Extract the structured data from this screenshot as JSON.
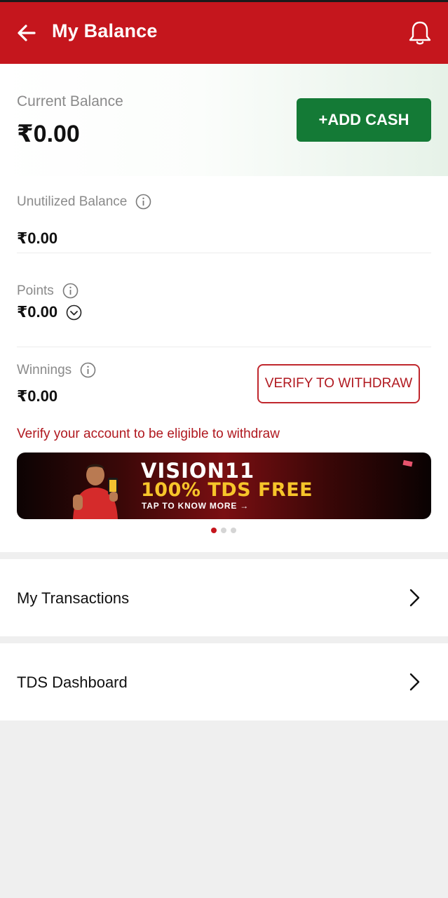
{
  "header": {
    "title": "My Balance",
    "back_icon": "arrow-left-icon",
    "bell_icon": "bell-icon",
    "color": "#c5161d"
  },
  "current_balance": {
    "label": "Current Balance",
    "value": "₹0.00",
    "add_cash_label": "+ADD CASH",
    "add_cash_color": "#147a36"
  },
  "unutilized": {
    "label": "Unutilized Balance",
    "value": "₹0.00"
  },
  "points": {
    "label": "Points",
    "value": "₹0.00"
  },
  "winnings": {
    "label": "Winnings",
    "value": "₹0.00",
    "verify_label": "VERIFY TO WITHDRAW",
    "note": "Verify your account to be eligible to withdraw"
  },
  "banner": {
    "brand": "VISION11",
    "headline": "100% TDS FREE",
    "cta": "TAP TO KNOW MORE →",
    "slides": 3,
    "active_slide": 1
  },
  "menu": [
    {
      "label": "My Transactions",
      "icon": "chevron-right-icon"
    },
    {
      "label": "TDS Dashboard",
      "icon": "chevron-right-icon"
    }
  ]
}
